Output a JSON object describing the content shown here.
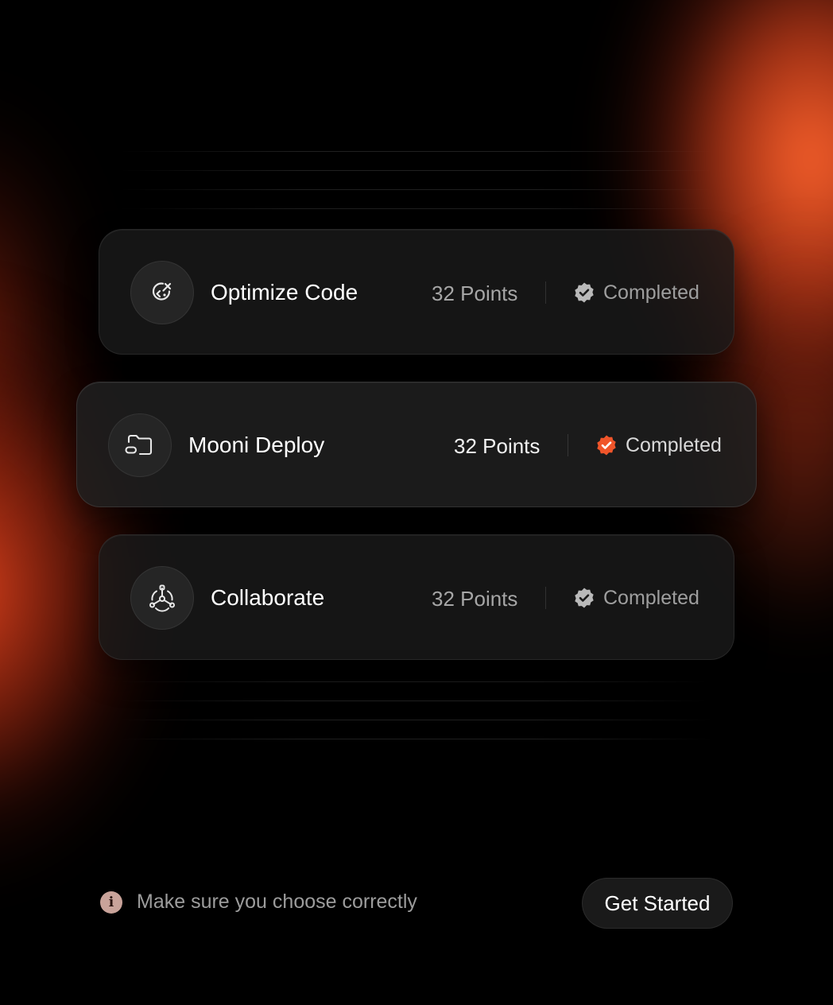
{
  "tasks": [
    {
      "title": "Optimize Code",
      "points": "32 Points",
      "status": "Completed",
      "icon": "code-optimize-icon",
      "badge_color": "#b9b9b9",
      "highlighted": false
    },
    {
      "title": "Mooni Deploy",
      "points": "32 Points",
      "status": "Completed",
      "icon": "folder-deploy-icon",
      "badge_color": "#f0552a",
      "highlighted": true
    },
    {
      "title": "Collaborate",
      "points": "32 Points",
      "status": "Completed",
      "icon": "collaborate-network-icon",
      "badge_color": "#b9b9b9",
      "highlighted": false
    }
  ],
  "footer": {
    "note": "Make sure you choose correctly",
    "note_icon": "info-icon",
    "cta_label": "Get Started"
  },
  "colors": {
    "accent": "#f0552a",
    "background": "#000000",
    "card": "#1a1a1a"
  }
}
